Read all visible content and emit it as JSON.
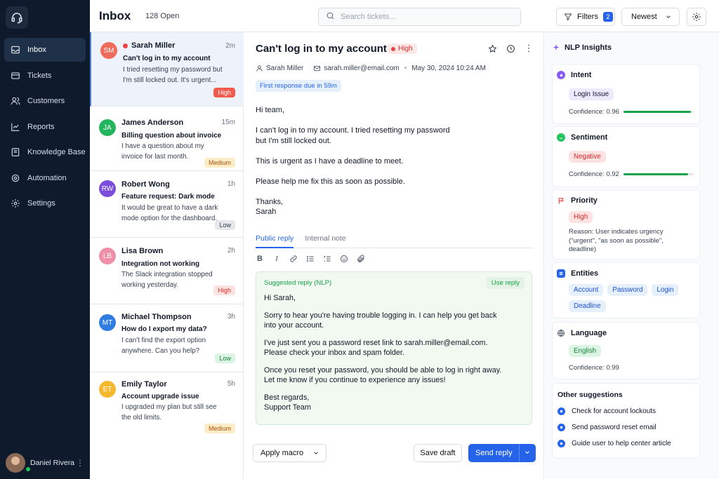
{
  "sidebar": {
    "logo_icon": "headset-icon",
    "items": [
      {
        "label": "Inbox",
        "icon": "inbox-icon",
        "active": true
      },
      {
        "label": "Tickets",
        "icon": "ticket-icon"
      },
      {
        "label": "Customers",
        "icon": "users-icon"
      },
      {
        "label": "Reports",
        "icon": "chart-icon"
      },
      {
        "label": "Knowledge Base",
        "icon": "book-icon"
      },
      {
        "label": "Automation",
        "icon": "automation-icon"
      },
      {
        "label": "Settings",
        "icon": "gear-icon"
      }
    ],
    "user": {
      "name": "Daniel Rivera",
      "status": "online"
    }
  },
  "header": {
    "title": "Inbox",
    "open_count": "128 Open",
    "search_placeholder": "Search tickets...",
    "filters_label": "Filters",
    "filters_count": "2",
    "sort_label": "Newest"
  },
  "tickets": [
    {
      "initials": "SM",
      "name": "Sarah Miller",
      "time": "2m",
      "subject": "Can't log in to my account",
      "preview": "I tried resetting my password but I'm still locked out. It's urgent...",
      "priority": "High",
      "avatar_color": "#ef6b5b",
      "unread": true,
      "selected": true
    },
    {
      "initials": "JA",
      "name": "James Anderson",
      "time": "15m",
      "subject": "Billing question about invoice",
      "preview": "I have a question about my invoice for last month.",
      "priority": "Medium",
      "avatar_color": "#22b55e"
    },
    {
      "initials": "RW",
      "name": "Robert Wong",
      "time": "1h",
      "subject": "Feature request: Dark mode",
      "preview": "It would be great to have a dark mode option for the dashboard.",
      "priority": "Low",
      "avatar_color": "#7c4ddb"
    },
    {
      "initials": "LB",
      "name": "Lisa Brown",
      "time": "2h",
      "subject": "Integration not working",
      "preview": "The Slack integration stopped working yesterday.",
      "priority": "High",
      "avatar_color": "#ef8fa8"
    },
    {
      "initials": "MT",
      "name": "Michael Thompson",
      "time": "3h",
      "subject": "How do I export my data?",
      "preview": "I can't find the export option anywhere. Can you help?",
      "priority": "Low",
      "avatar_color": "#2f7de1"
    },
    {
      "initials": "ET",
      "name": "Emily Taylor",
      "time": "5h",
      "subject": "Account upgrade issue",
      "preview": "I upgraded my plan but still see the old limits.",
      "priority": "Medium",
      "avatar_color": "#f5b82e"
    }
  ],
  "priority_colors": {
    "High": {
      "bg": "#fde2e2",
      "fg": "#dc2626"
    },
    "Medium": {
      "bg": "#fdecc8",
      "fg": "#b45309"
    },
    "Low": {
      "bg": "#e5e7eb",
      "fg": "#374151"
    },
    "LowGreen": {
      "bg": "#dcf5e3",
      "fg": "#15803d"
    }
  },
  "detail": {
    "title": "Can't log in to my account",
    "priority": "High",
    "customer": "Sarah Miller",
    "email": "sarah.miller@email.com",
    "date": "May 30, 2024 10:24 AM",
    "sla": "First response due in 59m",
    "body": [
      "Hi team,",
      "I can't log in to my account. I tried resetting my password\nbut I'm still locked out.",
      "This is urgent as I have a deadline to meet.",
      "Please help me fix this as soon as possible.",
      "Thanks,\nSarah"
    ],
    "tabs": [
      "Public reply",
      "Internal note"
    ],
    "suggested_label": "Suggested reply (NLP)",
    "use_reply": "Use reply",
    "suggested_body": [
      "Hi Sarah,",
      "Sorry to hear you're having trouble logging in. I can help you get back\ninto your account.",
      "I've just sent you a password reset link to sarah.miller@email.com.\nPlease check your inbox and spam folder.",
      "Once you reset your password, you should be able to log in right away.\nLet me know if you continue to experience any issues!",
      "Best regards,\nSupport Team"
    ],
    "macro_label": "Apply macro",
    "draft_label": "Save draft",
    "send_label": "Send reply"
  },
  "insights": {
    "title": "NLP Insights",
    "intent": {
      "title": "Intent",
      "value": "Login Issue",
      "confidence_label": "Confidence: 0.96",
      "confidence": 0.96
    },
    "sentiment": {
      "title": "Sentiment",
      "value": "Negative",
      "confidence_label": "Confidence: 0.92",
      "confidence": 0.92
    },
    "priority": {
      "title": "Priority",
      "value": "High",
      "reason": "Reason: User indicates urgency (\"urgent\", \"as soon as possible\", deadline)"
    },
    "entities": {
      "title": "Entities",
      "values": [
        "Account",
        "Password",
        "Login",
        "Deadline"
      ]
    },
    "language": {
      "title": "Language",
      "value": "English",
      "confidence_label": "Confidence: 0.99"
    },
    "other": {
      "title": "Other suggestions",
      "items": [
        "Check for account lockouts",
        "Send password reset email",
        "Guide user to help center article"
      ]
    }
  }
}
